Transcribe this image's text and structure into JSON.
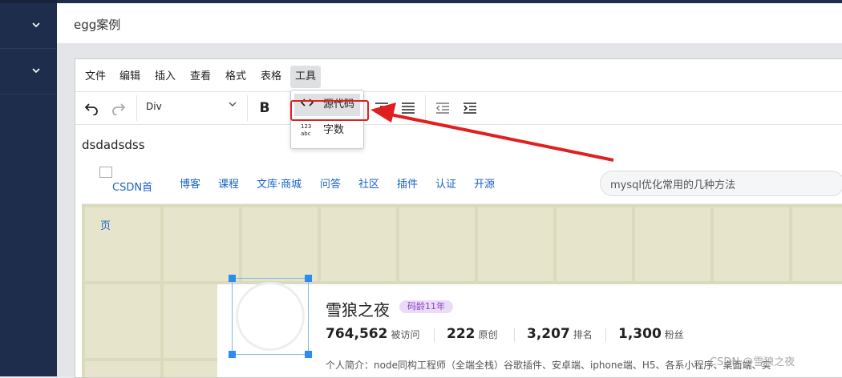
{
  "app": {
    "title": "egg案例"
  },
  "menubar": {
    "items": [
      "文件",
      "编辑",
      "插入",
      "查看",
      "格式",
      "表格",
      "工具"
    ]
  },
  "toolbar": {
    "block_format": "Div"
  },
  "tools_menu": {
    "items": [
      {
        "icon": "<>",
        "label": "源代码"
      },
      {
        "icon": "123",
        "label": "字数"
      }
    ]
  },
  "editor": {
    "text": "dsdadsdss"
  },
  "csdn": {
    "logo_text": "CSDN首",
    "nav": [
      "博客",
      "课程",
      "文库·商城",
      "问答",
      "社区",
      "插件",
      "认证",
      "开源"
    ],
    "search_placeholder": "mysql优化常用的几种方法",
    "page_label": "页",
    "profile": {
      "name": "雪狼之夜",
      "badge": "码龄11年",
      "stats": [
        {
          "num": "764,562",
          "label": "被访问"
        },
        {
          "num": "222",
          "label": "原创"
        },
        {
          "num": "3,207",
          "label": "排名"
        },
        {
          "num": "1,300",
          "label": "粉丝"
        }
      ],
      "bio": "个人简介：node同构工程师（全端全栈）谷歌插件、安卓端、iphone端、H5、各系小程序、桌面端、实"
    }
  },
  "watermark": "CSDN @雪狼之夜",
  "colors": {
    "sidebar": "#1f2d4d",
    "highlight": "#e02020",
    "link": "#1a63c6"
  }
}
